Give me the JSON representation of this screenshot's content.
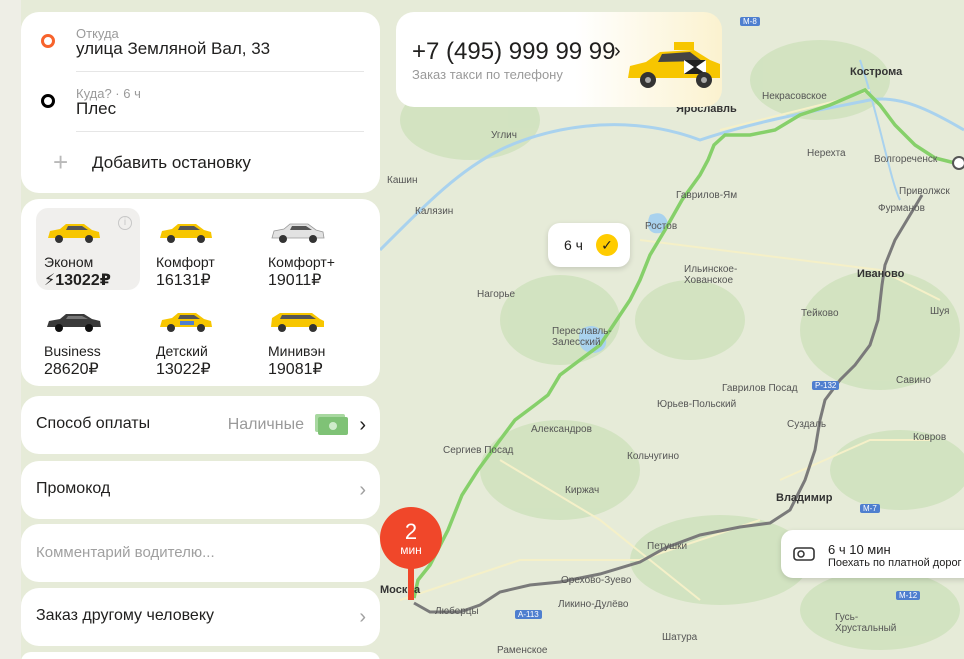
{
  "route": {
    "from_label": "Откуда",
    "from_value": "улица Земляной Вал, 33",
    "to_label": "Куда? · 6 ч",
    "to_value": "Плес",
    "add_stop": "Добавить остановку"
  },
  "tariffs": [
    {
      "name": "Эконом",
      "price": "⚡13022₽",
      "icon": "economy-car-icon",
      "color": "#f7c600"
    },
    {
      "name": "Комфорт",
      "price": "16131₽",
      "icon": "comfort-car-icon",
      "color": "#f7c600"
    },
    {
      "name": "Комфорт+",
      "price": "19011₽",
      "icon": "comfort-plus-car-icon",
      "color": "#e6e6e6"
    },
    {
      "name": "Business",
      "price": "28620₽",
      "icon": "business-car-icon",
      "color": "#3a3a3a"
    },
    {
      "name": "Детский",
      "price": "13022₽",
      "icon": "kids-car-icon",
      "color": "#f7c600"
    },
    {
      "name": "Минивэн",
      "price": "19081₽",
      "icon": "minivan-icon",
      "color": "#f7c600"
    }
  ],
  "options": {
    "payment_label": "Способ оплаты",
    "payment_value": "Наличные",
    "promo_label": "Промокод",
    "comment_placeholder": "Комментарий водителю...",
    "other_person_label": "Заказ другому человеку"
  },
  "phone": {
    "number": "+7 (495) 999 99 99",
    "subtitle": "Заказ такси по телефону"
  },
  "map": {
    "eta_bubble": "6 ч",
    "pickup_eta_value": "2",
    "pickup_eta_unit": "мин",
    "toll_time": "6 ч 10 мин",
    "toll_text": "Поехать по платной дорог",
    "route_color": "#86d06a",
    "alt_route_color": "#7a7a7a",
    "accent_color": "#f0472a",
    "labels": [
      {
        "text": "Кострома",
        "big": true
      },
      {
        "text": "Ярославль",
        "big": true
      },
      {
        "text": "Некрасовское"
      },
      {
        "text": "Углич"
      },
      {
        "text": "Нерехта"
      },
      {
        "text": "Волгореченск"
      },
      {
        "text": "Приволжск"
      },
      {
        "text": "Фурманов"
      },
      {
        "text": "Кашин"
      },
      {
        "text": "Калязин"
      },
      {
        "text": "Гаврилов-Ям"
      },
      {
        "text": "Ростов"
      },
      {
        "text": "Ильинское-Хованское"
      },
      {
        "text": "Иваново",
        "big": true
      },
      {
        "text": "Нагорье"
      },
      {
        "text": "Переславль-Залесский"
      },
      {
        "text": "Тейково"
      },
      {
        "text": "Шуя"
      },
      {
        "text": "Гаврилов Посад"
      },
      {
        "text": "Савино"
      },
      {
        "text": "Юрьев-Польский"
      },
      {
        "text": "Александров"
      },
      {
        "text": "Суздаль"
      },
      {
        "text": "Ковров"
      },
      {
        "text": "Сергиев Посад"
      },
      {
        "text": "Кольчугино"
      },
      {
        "text": "Киржач"
      },
      {
        "text": "Владимир",
        "big": true
      },
      {
        "text": "Петушки"
      },
      {
        "text": "Орехово-Зуево"
      },
      {
        "text": "Москва",
        "big": true
      },
      {
        "text": "Ликино-Дулёво"
      },
      {
        "text": "Гусь-Хрустальный"
      },
      {
        "text": "Шатура"
      },
      {
        "text": "Раменское"
      },
      {
        "text": "Люберцы"
      }
    ],
    "roads": [
      "М-8",
      "M-7",
      "M-12",
      "А-113",
      "Р-132"
    ]
  }
}
